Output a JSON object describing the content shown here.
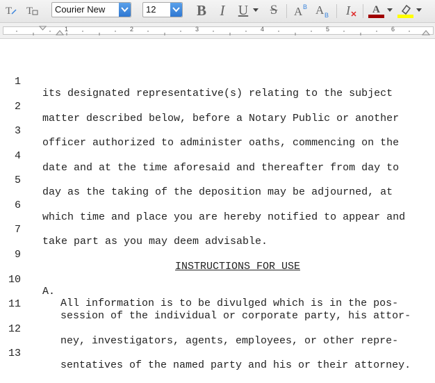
{
  "toolbar": {
    "font_name": "Courier New",
    "font_size": "12",
    "colors": {
      "font_color_swatch": "#a00000",
      "highlight_swatch": "#ffff00",
      "accent": "#3a84dc"
    }
  },
  "ruler": {
    "numbers": [
      "1",
      "2",
      "3",
      "4",
      "5",
      "6"
    ]
  },
  "document": {
    "lines": [
      {
        "num": "1",
        "text": "its designated representative(s) relating to the subject"
      },
      {
        "num": "2",
        "text": "matter described below, before a Notary Public or another"
      },
      {
        "num": "3",
        "text": "officer authorized to administer oaths, commencing on the"
      },
      {
        "num": "4",
        "text": "date and at the time aforesaid and thereafter from day to"
      },
      {
        "num": "5",
        "text": "day as the taking of the deposition may be adjourned, at"
      },
      {
        "num": "6",
        "text": "which time and place you are hereby notified to appear and"
      },
      {
        "num": "7",
        "text": "take part as you may deem advisable."
      }
    ],
    "heading": {
      "num": "9",
      "text": "INSTRUCTIONS FOR USE"
    },
    "item_a": {
      "marker": "A.",
      "lines": [
        {
          "num": "10",
          "text": "All information is to be divulged which is in the pos-"
        },
        {
          "num": "11",
          "text": "session of the individual or corporate party, his attor-"
        },
        {
          "num": "12",
          "text": "ney, investigators, agents, employees, or other repre-"
        },
        {
          "num": "13",
          "text": "sentatives of the named party and his or their attorney."
        }
      ]
    }
  }
}
